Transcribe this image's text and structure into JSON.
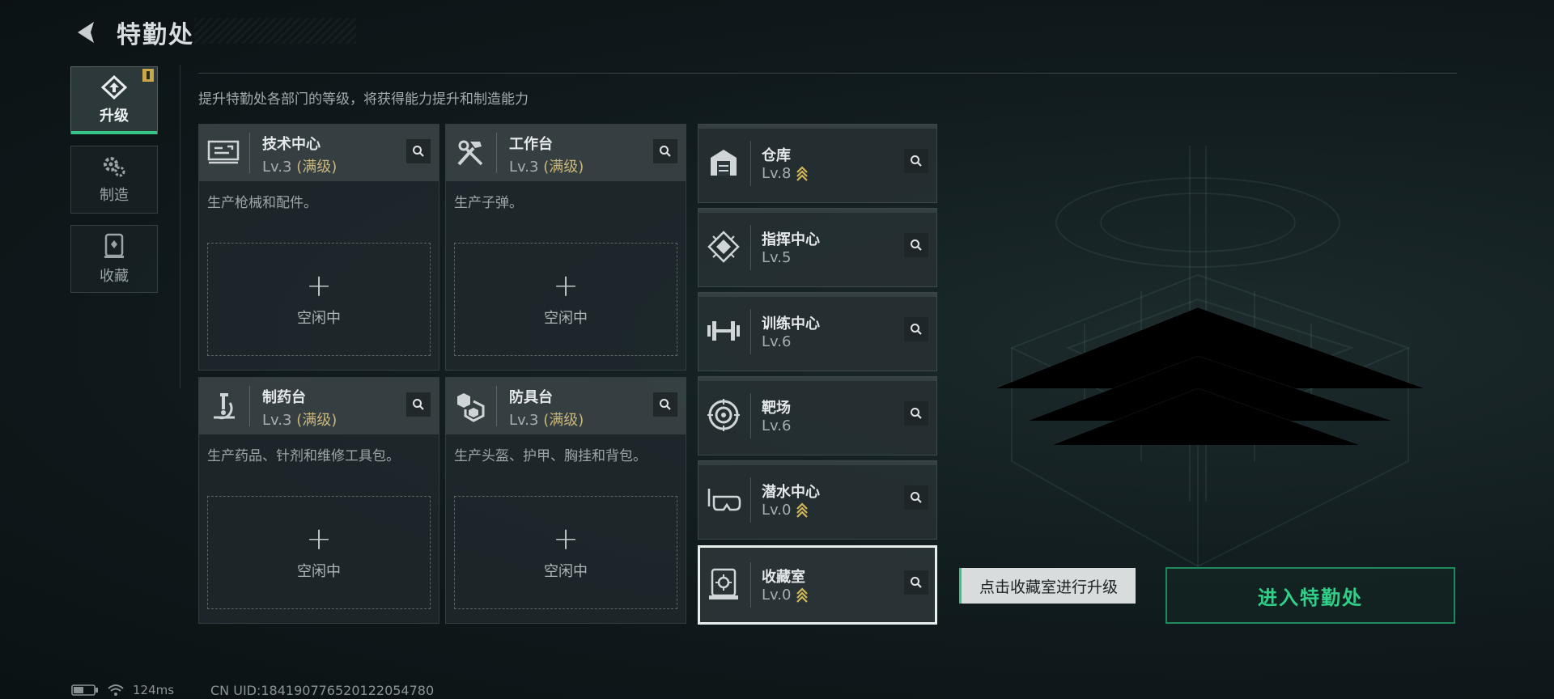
{
  "header": {
    "title": "特勤处",
    "back_icon": "back-arrow-icon"
  },
  "nav": {
    "items": [
      {
        "label": "升级",
        "icon": "upgrade-icon",
        "active": true,
        "badge": true
      },
      {
        "label": "制造",
        "icon": "gears-icon",
        "active": false
      },
      {
        "label": "收藏",
        "icon": "collection-icon",
        "active": false
      }
    ]
  },
  "subtitle": "提升特勤处各部门的等级，将获得能力提升和制造能力",
  "workshops": [
    {
      "name": "技术中心",
      "level": "Lv.3",
      "max": "(满级)",
      "desc": "生产枪械和配件。",
      "slot": "空闲中",
      "icon": "tech-center-icon"
    },
    {
      "name": "工作台",
      "level": "Lv.3",
      "max": "(满级)",
      "desc": "生产子弹。",
      "slot": "空闲中",
      "icon": "workbench-icon"
    },
    {
      "name": "制药台",
      "level": "Lv.3",
      "max": "(满级)",
      "desc": "生产药品、针剂和维修工具包。",
      "slot": "空闲中",
      "icon": "microscope-icon"
    },
    {
      "name": "防具台",
      "level": "Lv.3",
      "max": "(满级)",
      "desc": "生产头盔、护甲、胸挂和背包。",
      "slot": "空闲中",
      "icon": "armor-icon"
    }
  ],
  "departments": [
    {
      "name": "仓库",
      "level": "Lv.8",
      "upgradable": true,
      "icon": "warehouse-icon"
    },
    {
      "name": "指挥中心",
      "level": "Lv.5",
      "upgradable": false,
      "icon": "command-center-icon"
    },
    {
      "name": "训练中心",
      "level": "Lv.6",
      "upgradable": false,
      "icon": "dumbbell-icon"
    },
    {
      "name": "靶场",
      "level": "Lv.6",
      "upgradable": false,
      "icon": "target-icon"
    },
    {
      "name": "潜水中心",
      "level": "Lv.0",
      "upgradable": true,
      "icon": "diving-mask-icon"
    },
    {
      "name": "收藏室",
      "level": "Lv.0",
      "upgradable": true,
      "icon": "collection-room-icon",
      "selected": true
    }
  ],
  "hint": "点击收藏室进行升级",
  "enter_button": "进入特勤处",
  "status": {
    "ping": "124ms",
    "uid": "CN UID:18419077652012205478​0"
  },
  "colors": {
    "accent": "#36c489",
    "max_level": "#c9b77b",
    "upgrade_arrow": "#d4b656"
  }
}
